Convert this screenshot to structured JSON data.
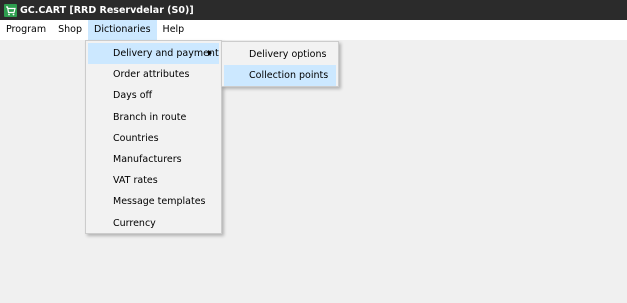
{
  "window": {
    "title": "GC.CART [RRD Reservdelar (S0)]",
    "icon": "cart-icon"
  },
  "menubar": {
    "items": [
      {
        "label": "Program"
      },
      {
        "label": "Shop"
      },
      {
        "label": "Dictionaries"
      },
      {
        "label": "Help"
      }
    ]
  },
  "dictionaries_menu": {
    "items": [
      {
        "label": "Delivery and payment"
      },
      {
        "label": "Order attributes"
      },
      {
        "label": "Days off"
      },
      {
        "label": "Branch in route"
      },
      {
        "label": "Countries"
      },
      {
        "label": "Manufacturers"
      },
      {
        "label": "VAT rates"
      },
      {
        "label": "Message templates"
      },
      {
        "label": "Currency"
      }
    ]
  },
  "delivery_submenu": {
    "items": [
      {
        "label": "Delivery options"
      },
      {
        "label": "Collection points"
      }
    ]
  },
  "colors": {
    "titlebar_bg": "#2b2b2b",
    "highlight": "#cce8ff",
    "icon_green": "#2e9e4f"
  }
}
